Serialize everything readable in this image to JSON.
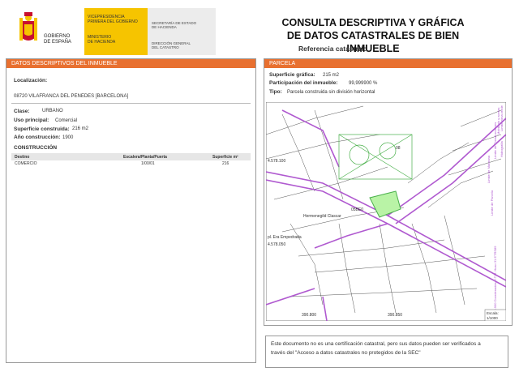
{
  "header": {
    "gov_lines": [
      "VICEPRESIDENCIA",
      "PRIMERA DEL GOBIERNO",
      "MINISTERIO",
      "DE HACIENDA"
    ],
    "gob_lines": [
      "GOBIERNO",
      "DE ESPAÑA"
    ],
    "sec_lines": [
      "SECRETARÍA DE ESTADO",
      "DE HACIENDA",
      "DIRECCIÓN GENERAL",
      "DEL CATASTRO"
    ],
    "title_line1": "CONSULTA DESCRIPTIVA Y GRÁFICA",
    "title_line2": "DE DATOS CATASTRALES DE BIEN INMUEBLE",
    "ref_label": "Referencia catastral:"
  },
  "left": {
    "section_title": "DATOS DESCRIPTIVOS DEL INMUEBLE",
    "localizacion_label": "Localización:",
    "address": "08720 VILAFRANCA DEL PENEDES [BARCELONA]",
    "clase_label": "Clase:",
    "clase_value": "URBANO",
    "uso_label": "Uso principal:",
    "uso_value": "Comercial",
    "superficie_label": "Superficie construida:",
    "superficie_value": "216 m2",
    "anio_label": "Año construcción:",
    "anio_value": "1900",
    "construccion_title": "CONSTRUCCIÓN",
    "table_headers": [
      "Destino",
      "Escalera/Planta/Puerta",
      "Superficie m²"
    ],
    "table_rows": [
      [
        "COMERCIO",
        "1/00/01",
        "216"
      ]
    ]
  },
  "right": {
    "section_title": "PARCELA",
    "sup_grafica_label": "Superficie gráfica:",
    "sup_grafica_value": "215 m2",
    "participacion_label": "Participación del inmueble:",
    "participacion_value": "99,999900 %",
    "tipo_label": "Tipo:",
    "tipo_value": "Parcela construida sin división horizontal",
    "map_labels": {
      "y_top": "4.578.100",
      "y_bottom": "4.578.050",
      "x_left": "390.800",
      "x_right": "390.850",
      "street": "pl. Era Empedrada",
      "street2": "Hermenegild Clascar",
      "parcel": "08",
      "parcel2": "05BE0",
      "escala_label": "Escala:",
      "escala_value": "1/1000",
      "legend": [
        "Límite de Manzana",
        "Límite de Parcela",
        "Límite de Construcciones",
        "Mobiliario y aceras",
        "Límite zona verde",
        "Hidrografía"
      ],
      "crs": "390.900 Coordenadas U.T.M. Huso 31 ETRS89"
    }
  },
  "note": {
    "line1": "Este documento no es una certificación catastral, pero sus datos pueden ser verificados a",
    "line2": "través del \"Acceso a datos catastrales no protegidos de la SEC\""
  }
}
